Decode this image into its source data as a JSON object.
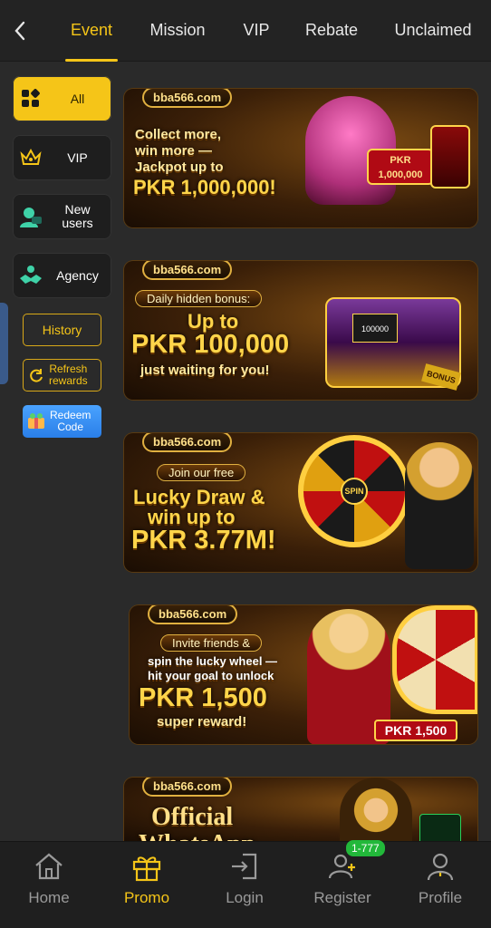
{
  "header": {
    "back_icon": "chevron-left-icon",
    "tabs": [
      {
        "label": "Event",
        "active": true
      },
      {
        "label": "Mission"
      },
      {
        "label": "VIP"
      },
      {
        "label": "Rebate"
      },
      {
        "label": "Unclaimed"
      }
    ]
  },
  "sidebar": {
    "items": [
      {
        "label": "All",
        "icon": "grid-icon",
        "active": true
      },
      {
        "label": "VIP",
        "icon": "crown-icon"
      },
      {
        "label": "New\nusers",
        "icon": "new-user-icon"
      },
      {
        "label": "Agency",
        "icon": "handshake-icon"
      }
    ],
    "history_label": "History",
    "refresh_label": "Refresh\nrewards",
    "redeem_label": "Redeem\nCode"
  },
  "banners": [
    {
      "logo": "bba566.com",
      "line1": "Collect more,",
      "line2": "win more —",
      "line3": "Jackpot up to",
      "line4": "PKR 1,000,000!",
      "badge": "PKR\n1,000,000"
    },
    {
      "logo": "bba566.com",
      "pill": "Daily hidden bonus:",
      "line1": "Up to",
      "line2": "PKR 100,000",
      "line3": "just waiting for you!",
      "badge": "100000",
      "badge2": "BONUS"
    },
    {
      "logo": "bba566.com",
      "pill": "Join our free",
      "line1": "Lucky Draw &",
      "line2": "win up to",
      "line3": "PKR 3.77M!",
      "wheel": "SPIN"
    },
    {
      "logo": "bba566.com",
      "pill": "Invite friends &",
      "line1": "spin the lucky wheel —",
      "line2": "hit your goal to unlock",
      "line3": "PKR 1,500",
      "line4": "super reward!",
      "badge": "PKR 1,500"
    },
    {
      "logo": "bba566.com",
      "line1": "Official",
      "line2": "WhatsApp"
    }
  ],
  "bottom_nav": [
    {
      "label": "Home",
      "icon": "home-icon"
    },
    {
      "label": "Promo",
      "icon": "gift-icon",
      "active": true
    },
    {
      "label": "Login",
      "icon": "login-icon"
    },
    {
      "label": "Register",
      "icon": "add-user-icon",
      "badge": "1-777"
    },
    {
      "label": "Profile",
      "icon": "profile-icon"
    }
  ],
  "colors": {
    "accent": "#f5c518",
    "background": "#2a2a2a",
    "badge_green": "#22b83a"
  }
}
